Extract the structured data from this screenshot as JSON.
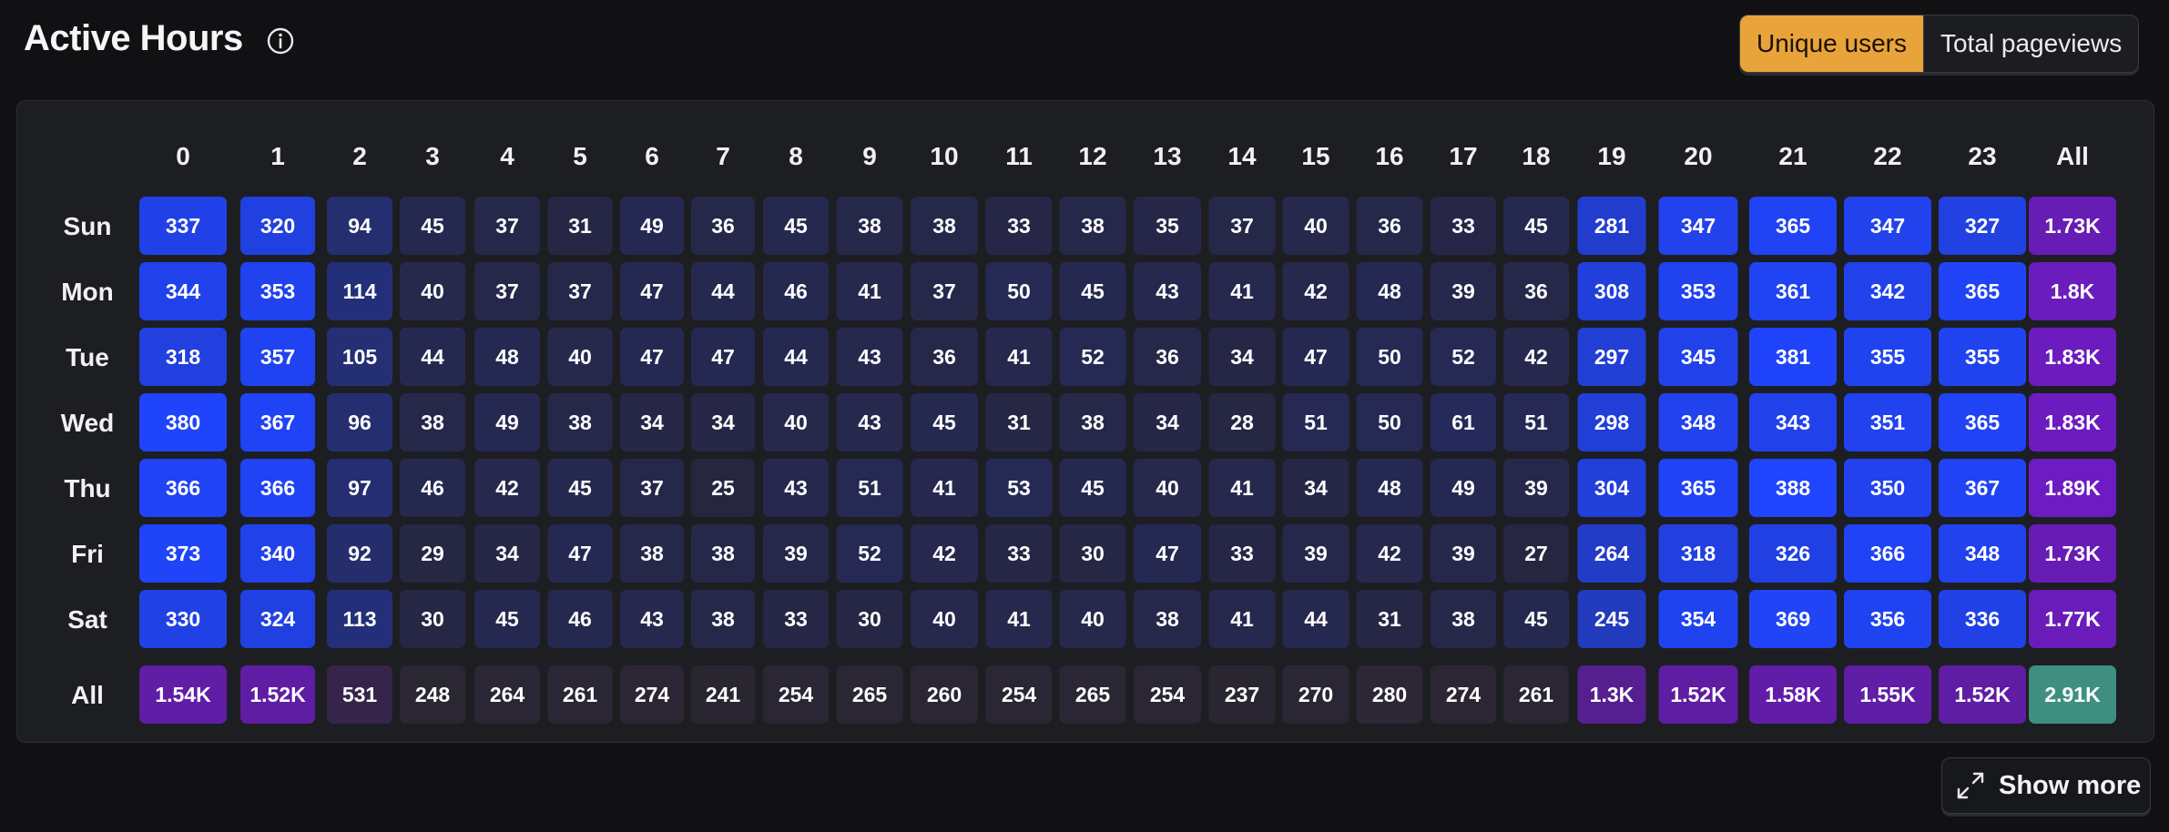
{
  "header": {
    "title": "Active Hours",
    "info_icon": "info-circle-icon"
  },
  "toggle": {
    "options": [
      "Unique users",
      "Total pageviews"
    ],
    "selected": "Unique users",
    "active_color": "#e9a33b"
  },
  "show_more": {
    "label": "Show more",
    "icon": "expand-icon"
  },
  "colors": {
    "cell_low": "#26263f",
    "cell_high": "#2045ff",
    "total_low": "#2a2631",
    "total_high": "#6e1bc4",
    "grand_total": "#3e8f7f",
    "panel": "#1d1e22"
  },
  "chart_data": {
    "type": "heatmap",
    "columns": [
      "0",
      "1",
      "2",
      "3",
      "4",
      "5",
      "6",
      "7",
      "8",
      "9",
      "10",
      "11",
      "12",
      "13",
      "14",
      "15",
      "16",
      "17",
      "18",
      "19",
      "20",
      "21",
      "22",
      "23"
    ],
    "rows": [
      "Sun",
      "Mon",
      "Tue",
      "Wed",
      "Thu",
      "Fri",
      "Sat"
    ],
    "values": [
      [
        337,
        320,
        94,
        45,
        37,
        31,
        49,
        36,
        45,
        38,
        38,
        33,
        38,
        35,
        37,
        40,
        36,
        33,
        45,
        281,
        347,
        365,
        347,
        327
      ],
      [
        344,
        353,
        114,
        40,
        37,
        37,
        47,
        44,
        46,
        41,
        37,
        50,
        45,
        43,
        41,
        42,
        48,
        39,
        36,
        308,
        353,
        361,
        342,
        365
      ],
      [
        318,
        357,
        105,
        44,
        48,
        40,
        47,
        47,
        44,
        43,
        36,
        41,
        52,
        36,
        34,
        47,
        50,
        52,
        42,
        297,
        345,
        381,
        355,
        355
      ],
      [
        380,
        367,
        96,
        38,
        49,
        38,
        34,
        34,
        40,
        43,
        45,
        31,
        38,
        34,
        28,
        51,
        50,
        61,
        51,
        298,
        348,
        343,
        351,
        365
      ],
      [
        366,
        366,
        97,
        46,
        42,
        45,
        37,
        25,
        43,
        51,
        41,
        53,
        45,
        40,
        41,
        34,
        48,
        49,
        39,
        304,
        365,
        388,
        350,
        367
      ],
      [
        373,
        340,
        92,
        29,
        34,
        47,
        38,
        38,
        39,
        52,
        42,
        33,
        30,
        47,
        33,
        39,
        42,
        39,
        27,
        264,
        318,
        326,
        366,
        348
      ],
      [
        330,
        324,
        113,
        30,
        45,
        46,
        43,
        38,
        33,
        30,
        40,
        41,
        40,
        38,
        41,
        44,
        31,
        38,
        45,
        245,
        354,
        369,
        356,
        336
      ]
    ],
    "total_label": "All",
    "row_totals": [
      "1.73K",
      "1.8K",
      "1.83K",
      "1.83K",
      "1.89K",
      "1.73K",
      "1.77K"
    ],
    "column_totals": [
      "1.54K",
      "1.52K",
      "531",
      "248",
      "264",
      "261",
      "274",
      "241",
      "254",
      "265",
      "260",
      "254",
      "265",
      "254",
      "237",
      "270",
      "280",
      "274",
      "261",
      "1.3K",
      "1.52K",
      "1.58K",
      "1.55K",
      "1.52K"
    ],
    "grand_total": "2.91K",
    "row_totals_numeric": [
      1730,
      1800,
      1830,
      1830,
      1890,
      1730,
      1770
    ],
    "column_totals_numeric": [
      1540,
      1520,
      531,
      248,
      264,
      261,
      274,
      241,
      254,
      265,
      260,
      254,
      265,
      254,
      237,
      270,
      280,
      274,
      261,
      1300,
      1520,
      1580,
      1550,
      1520
    ]
  }
}
